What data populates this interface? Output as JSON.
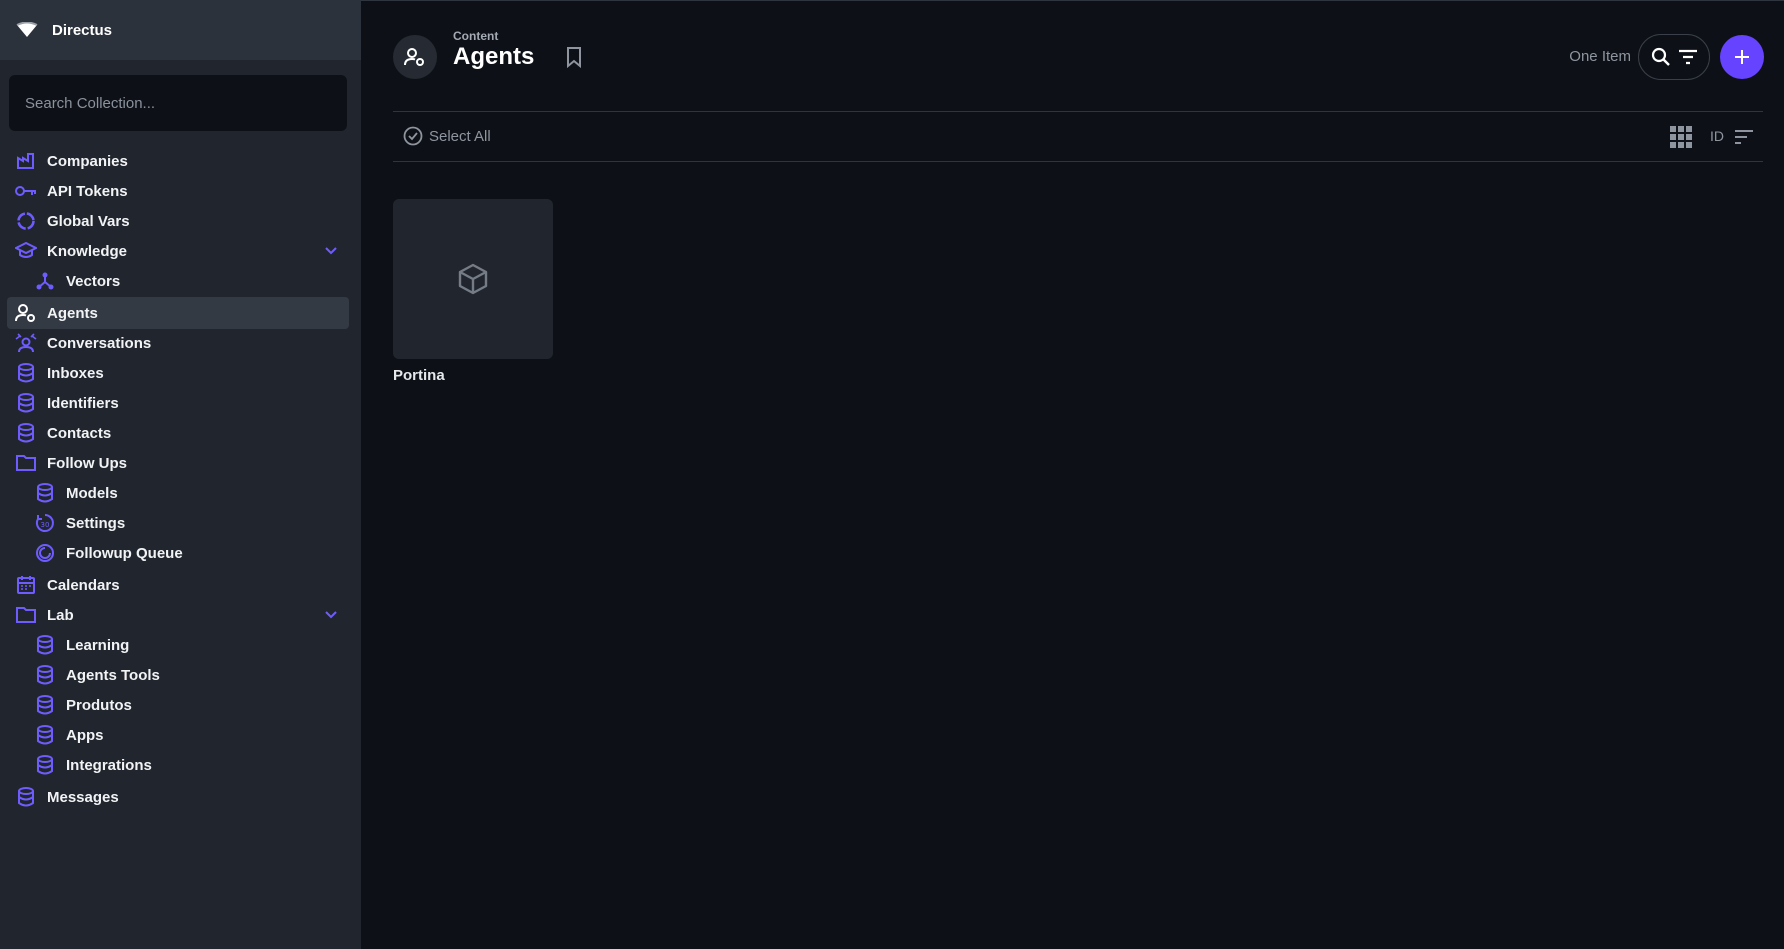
{
  "app": {
    "name": "Directus"
  },
  "sidebar": {
    "search_placeholder": "Search Collection...",
    "items": [
      {
        "label": "Companies",
        "icon": "factory-icon",
        "level": 0
      },
      {
        "label": "API Tokens",
        "icon": "key-icon",
        "level": 0
      },
      {
        "label": "Global Vars",
        "icon": "circle-progress-icon",
        "level": 0
      },
      {
        "label": "Knowledge",
        "icon": "graduation-cap-icon",
        "level": 0,
        "expanded": true
      },
      {
        "label": "Vectors",
        "icon": "hub-icon",
        "level": 1
      },
      {
        "label": "Agents",
        "icon": "user-gear-icon",
        "level": 0,
        "active": true
      },
      {
        "label": "Conversations",
        "icon": "group-chat-icon",
        "level": 0
      },
      {
        "label": "Inboxes",
        "icon": "database-icon",
        "level": 0
      },
      {
        "label": "Identifiers",
        "icon": "database-icon",
        "level": 0
      },
      {
        "label": "Contacts",
        "icon": "database-icon",
        "level": 0
      },
      {
        "label": "Follow Ups",
        "icon": "folder-icon",
        "level": 0
      },
      {
        "label": "Models",
        "icon": "database-icon",
        "level": 1
      },
      {
        "label": "Settings",
        "icon": "timer-30-icon",
        "level": 1
      },
      {
        "label": "Followup Queue",
        "icon": "cycle-icon",
        "level": 1
      },
      {
        "label": "Calendars",
        "icon": "calendar-icon",
        "level": 0
      },
      {
        "label": "Lab",
        "icon": "folder-icon",
        "level": 0,
        "expanded": true
      },
      {
        "label": "Learning",
        "icon": "database-icon",
        "level": 1
      },
      {
        "label": "Agents Tools",
        "icon": "database-icon",
        "level": 1
      },
      {
        "label": "Produtos",
        "icon": "database-icon",
        "level": 1
      },
      {
        "label": "Apps",
        "icon": "database-icon",
        "level": 1
      },
      {
        "label": "Integrations",
        "icon": "database-icon",
        "level": 1
      },
      {
        "label": "Messages",
        "icon": "database-icon",
        "level": 0
      }
    ]
  },
  "header": {
    "breadcrumb": "Content",
    "title": "Agents",
    "item_count": "One Item"
  },
  "toolbar": {
    "select_all_label": "Select All",
    "sort_field": "ID"
  },
  "cards": [
    {
      "title": "Portina",
      "icon": "cube-icon"
    }
  ],
  "colors": {
    "accent": "#6644ff",
    "sidebar_bg": "#21262e",
    "main_bg": "#0d1117"
  }
}
